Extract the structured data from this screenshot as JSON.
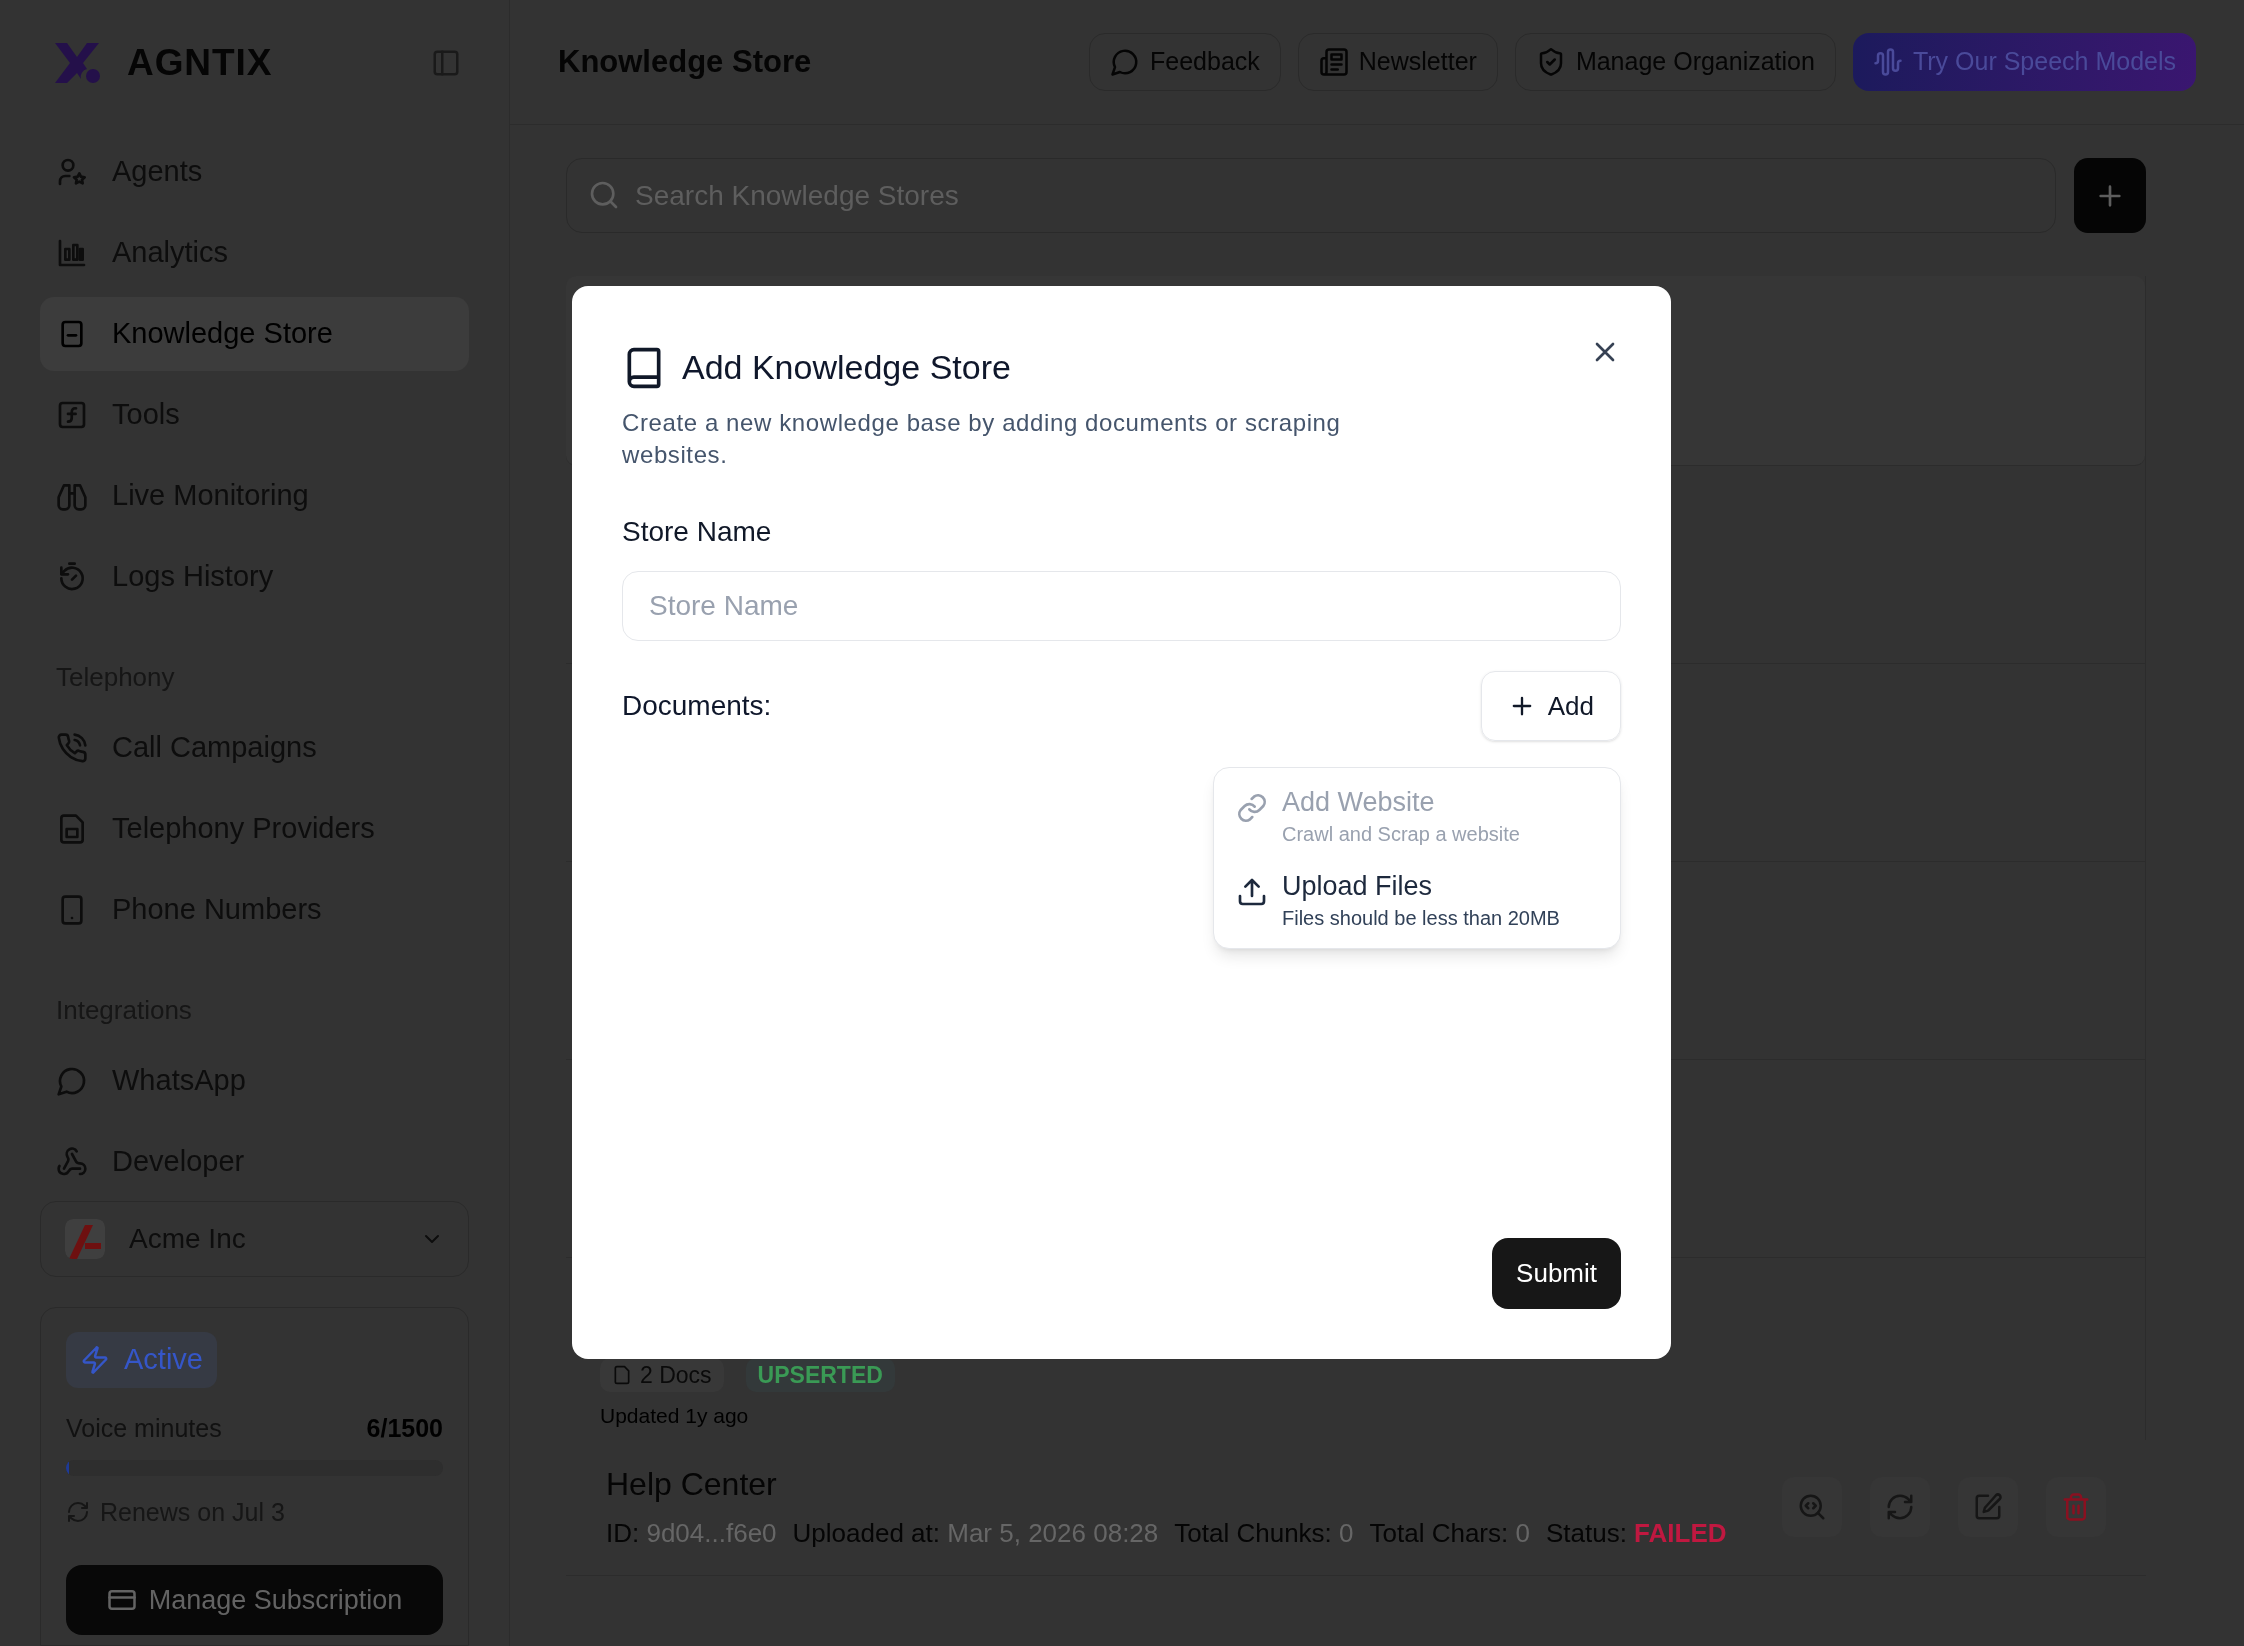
{
  "brand": {
    "name": "AGNTIX"
  },
  "sidebar": {
    "items": [
      {
        "label": "Agents",
        "selected": false
      },
      {
        "label": "Analytics",
        "selected": false
      },
      {
        "label": "Knowledge Store",
        "selected": true
      },
      {
        "label": "Tools",
        "selected": false
      },
      {
        "label": "Live Monitoring",
        "selected": false
      },
      {
        "label": "Logs History",
        "selected": false
      }
    ],
    "sections": [
      {
        "heading": "Telephony",
        "items": [
          {
            "label": "Call Campaigns",
            "selected": false
          },
          {
            "label": "Telephony Providers",
            "selected": false
          },
          {
            "label": "Phone Numbers",
            "selected": false
          }
        ]
      },
      {
        "heading": "Integrations",
        "items": [
          {
            "label": "WhatsApp",
            "selected": false
          },
          {
            "label": "Developer",
            "selected": false
          }
        ]
      }
    ]
  },
  "organization": {
    "name": "Acme Inc"
  },
  "subscription": {
    "status": "Active",
    "usage_label": "Voice minutes",
    "usage": "6/1500",
    "level": 0.004,
    "renewal": "Renews on Jul 3",
    "button": "Manage Subscription"
  },
  "header": {
    "title": "Knowledge Store",
    "buttons": [
      {
        "label": "Feedback",
        "kind": "outline"
      },
      {
        "label": "Newsletter",
        "kind": "outline"
      },
      {
        "label": "Manage Organization",
        "kind": "outline"
      },
      {
        "label": "Try Our Speech Models",
        "kind": "primary"
      }
    ]
  },
  "search": {
    "placeholder": "Search Knowledge Stores"
  },
  "store": {
    "docs": "2 Docs",
    "status": "UPSERTED",
    "updated": "Updated 1y ago"
  },
  "document": {
    "name": "Help Center",
    "fields": [
      {
        "label": "ID:",
        "value": "9d04...f6e0",
        "kind": "plain"
      },
      {
        "label": "Uploaded at:",
        "value": "Mar 5, 2026 08:28",
        "kind": "plain"
      },
      {
        "label": "Total Chunks:",
        "value": "0",
        "kind": "plain"
      },
      {
        "label": "Total Chars:",
        "value": "0",
        "kind": "plain"
      },
      {
        "label": "Status:",
        "value": "FAILED",
        "kind": "status"
      }
    ]
  },
  "dialog": {
    "title": "Add Knowledge Store",
    "description": "Create a new knowledge base by adding documents or scraping websites.",
    "field": {
      "label": "Store Name",
      "placeholder": "Store Name"
    },
    "documents_label": "Documents:",
    "add_button": "Add",
    "menu": [
      {
        "title": "Add Website",
        "subtitle": "Crawl and Scrap a website",
        "disabled": true
      },
      {
        "title": "Upload Files",
        "subtitle": "Files should be less than 20MB",
        "disabled": false
      }
    ],
    "submit": "Submit"
  }
}
